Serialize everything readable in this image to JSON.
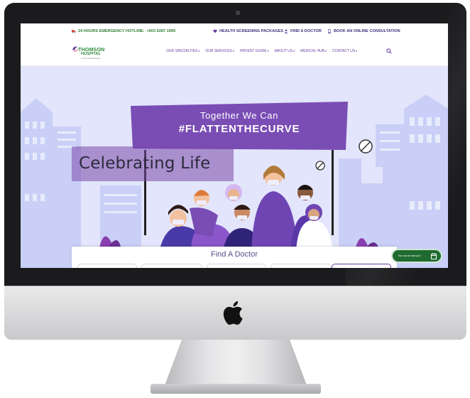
{
  "device": {
    "brand_logo": "apple-logo"
  },
  "topbar": {
    "emergency_label": "24 HOURS EMERGENCY HOTLINE:",
    "emergency_number": "+603 6287 1999",
    "screening_link": "HEALTH SCREENING PACKAGES",
    "find_doctor_link": "FIND A DOCTOR",
    "consultation_link": "BOOK AN ONLINE CONSULTATION"
  },
  "brand": {
    "name": "THOMSON",
    "subname": "HOSPITAL",
    "tagline": "KOTA DAMANSARA",
    "accent_color": "#6a3fa0",
    "green_color": "#2e8c3b"
  },
  "nav": {
    "items": [
      {
        "label": "OUR SPECIALTIES"
      },
      {
        "label": "OUR SERVICES"
      },
      {
        "label": "PATIENT GUIDE"
      },
      {
        "label": "ABOUT US"
      },
      {
        "label": "MEDICAL HUB"
      },
      {
        "label": "CONTACT US"
      }
    ],
    "search_icon": "search-icon"
  },
  "hero": {
    "banner_line1": "Together We Can",
    "banner_line2": "#FLATTENTHECURVE",
    "overlay_text": "Celebrating Life",
    "background_color": "#e2e5fb"
  },
  "find_doctor": {
    "title": "Find A Doctor"
  },
  "chat": {
    "label": "How can we help you?"
  }
}
